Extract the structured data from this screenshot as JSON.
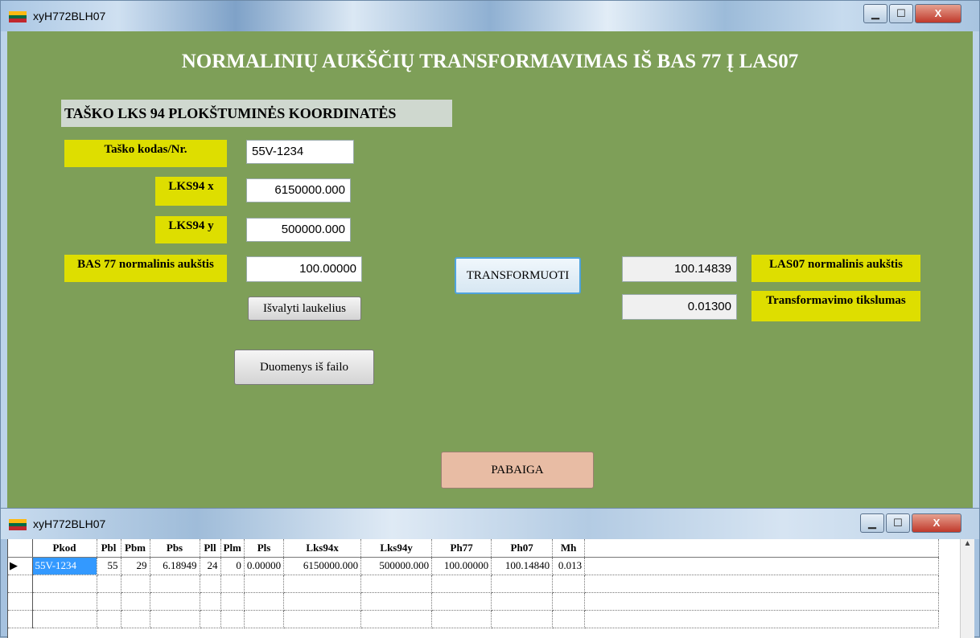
{
  "main_window": {
    "title": "xyH772BLH07",
    "controls": {
      "minimize": "▁",
      "maximize": "☐",
      "close": "X"
    },
    "heading": "NORMALINIŲ AUKŠČIŲ TRANSFORMAVIMAS IŠ BAS 77 Į LAS07",
    "section_label": "TAŠKO LKS 94 PLOKŠTUMINĖS KOORDINATĖS",
    "labels": {
      "point_code": "Taško kodas/Nr.",
      "lks94x": "LKS94 x",
      "lks94y": "LKS94 y",
      "bas77": "BAS 77 normalinis aukštis",
      "las07": "LAS07 normalinis aukštis",
      "accuracy": "Transformavimo tikslumas"
    },
    "fields": {
      "point_code": "55V-1234",
      "lks94x": "6150000.000",
      "lks94y": "500000.000",
      "bas77": "100.00000",
      "las07": "100.14839",
      "accuracy": "0.01300"
    },
    "buttons": {
      "clear": "Išvalyti laukelius",
      "from_file": "Duomenys iš failo",
      "transform": "TRANSFORMUOTI",
      "end": "PABAIGA"
    }
  },
  "grid_window": {
    "title": "xyH772BLH07",
    "controls": {
      "minimize": "▁",
      "maximize": "☐",
      "close": "X"
    },
    "scroll_up": "▲",
    "row_indicator": "▶",
    "columns": [
      "Pkod",
      "Pbl",
      "Pbm",
      "Pbs",
      "Pll",
      "Plm",
      "Pls",
      "Lks94x",
      "Lks94y",
      "Ph77",
      "Ph07",
      "Mh"
    ],
    "rows": [
      [
        "55V-1234",
        "55",
        "29",
        "6.18949",
        "24",
        "0",
        "0.00000",
        "6150000.000",
        "500000.000",
        "100.00000",
        "100.14840",
        "0.013"
      ]
    ]
  },
  "colors": {
    "form_background": "#7e9f58",
    "label_yellow": "#dede00",
    "heading_text": "#ffffff",
    "end_button": "#e8bca4",
    "selected_cell": "#3399ff"
  }
}
